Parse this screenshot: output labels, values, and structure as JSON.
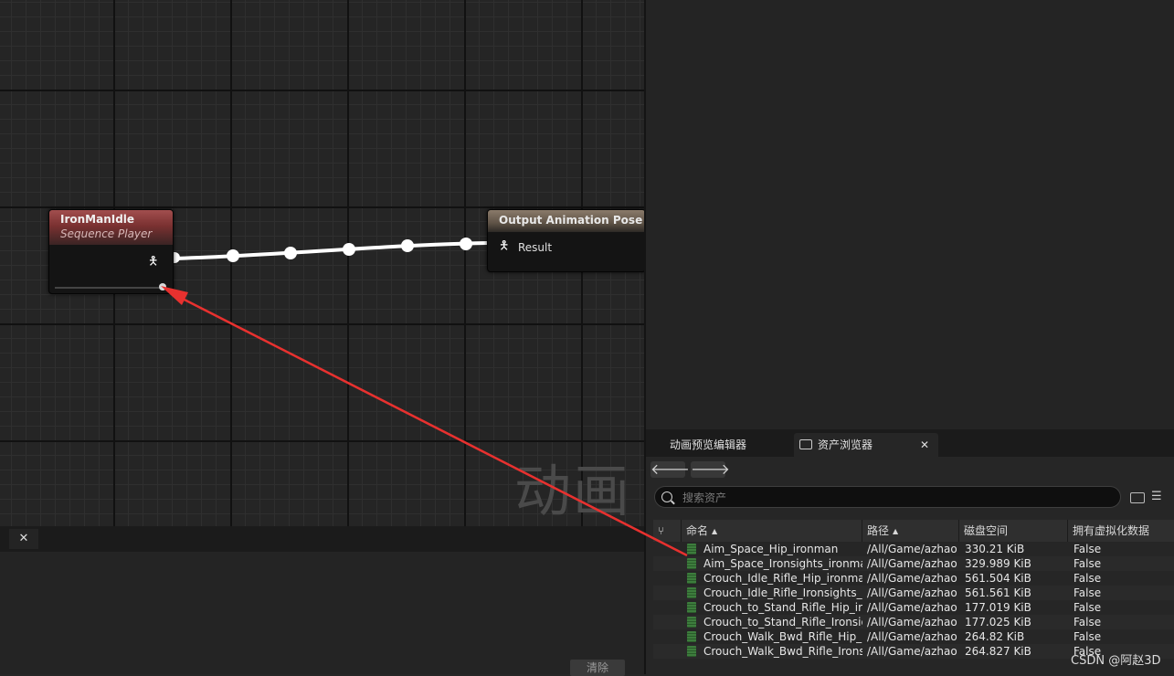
{
  "graph": {
    "watermark": "动画",
    "seq_node": {
      "title": "IronManIdle",
      "subtitle": "Sequence Player"
    },
    "output_node": {
      "title": "Output Animation Pose",
      "pin_label": "Result"
    }
  },
  "bottom_left": {
    "clear_label": "清除"
  },
  "content_browser": {
    "tab_anim_preview": "动画预览编辑器",
    "tab_assets": "资产浏览器",
    "search_placeholder": "搜索资产",
    "columns": {
      "name": "命名",
      "path": "路径",
      "size": "磁盘空间",
      "virtualized": "拥有虚拟化数据"
    },
    "rows": [
      {
        "name": "Aim_Space_Hip_ironman",
        "path": "/All/Game/azhao",
        "size": "330.21 KiB",
        "virtualized": "False"
      },
      {
        "name": "Aim_Space_Ironsights_ironman",
        "path": "/All/Game/azhao",
        "size": "329.989 KiB",
        "virtualized": "False"
      },
      {
        "name": "Crouch_Idle_Rifle_Hip_ironman",
        "path": "/All/Game/azhao",
        "size": "561.504 KiB",
        "virtualized": "False"
      },
      {
        "name": "Crouch_Idle_Rifle_Ironsights_ironman",
        "path": "/All/Game/azhao",
        "size": "561.561 KiB",
        "virtualized": "False"
      },
      {
        "name": "Crouch_to_Stand_Rifle_Hip_ironman",
        "path": "/All/Game/azhao",
        "size": "177.019 KiB",
        "virtualized": "False"
      },
      {
        "name": "Crouch_to_Stand_Rifle_Ironsights_ironman",
        "path": "/All/Game/azhao",
        "size": "177.025 KiB",
        "virtualized": "False"
      },
      {
        "name": "Crouch_Walk_Bwd_Rifle_Hip_ironman",
        "path": "/All/Game/azhao",
        "size": "264.82 KiB",
        "virtualized": "False"
      },
      {
        "name": "Crouch_Walk_Bwd_Rifle_Ironsights_ironman",
        "path": "/All/Game/azhao",
        "size": "264.827 KiB",
        "virtualized": "False"
      }
    ]
  },
  "watermark_csdn": "CSDN @阿赵3D",
  "colors": {
    "arrow": "#e8312f",
    "seq_header": "#8c3c3c",
    "output_header": "#6e6052"
  }
}
